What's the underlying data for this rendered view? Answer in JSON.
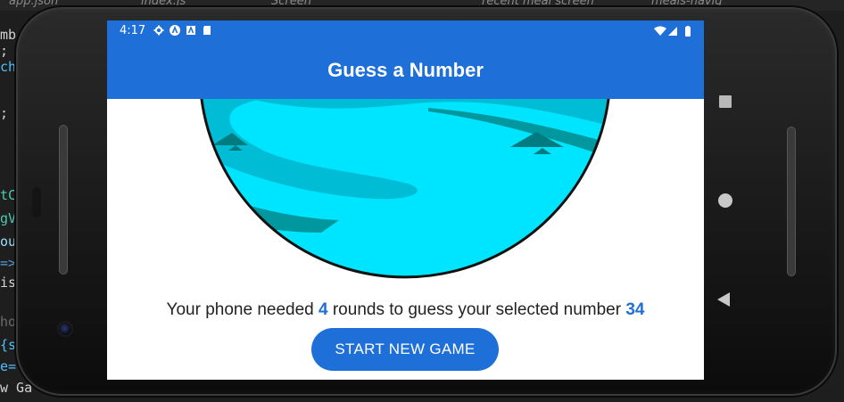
{
  "editor": {
    "tabs": [
      "app.json",
      "index.js",
      "Screen",
      "recent meal screen",
      "meals-navig"
    ],
    "code_fragments": [
      "mb",
      ";",
      "ch",
      ";",
      "tC",
      "gV",
      "ou",
      "=>",
      "is",
      "ho",
      "{s",
      "e=",
      "w Ga"
    ]
  },
  "status_bar": {
    "time": "4:17",
    "left_icons": [
      "gear-icon",
      "a-circle-icon",
      "a-square-icon",
      "sd-card-icon"
    ],
    "right_icons": [
      "wifi-icon",
      "signal-icon",
      "battery-icon"
    ]
  },
  "header": {
    "title": "Guess a Number"
  },
  "summary": {
    "prefix": "Your phone needed",
    "rounds": "4",
    "middle": "rounds to guess your selected number",
    "number": "34"
  },
  "actions": {
    "start_new_game": "START NEW GAME"
  },
  "nav_buttons": [
    "square-icon",
    "circle-icon",
    "back-triangle-icon"
  ],
  "colors": {
    "primary": "#1e6fd8",
    "water_light": "#00e5ff",
    "water_mid": "#00bcd4",
    "water_dark": "#00979e"
  }
}
